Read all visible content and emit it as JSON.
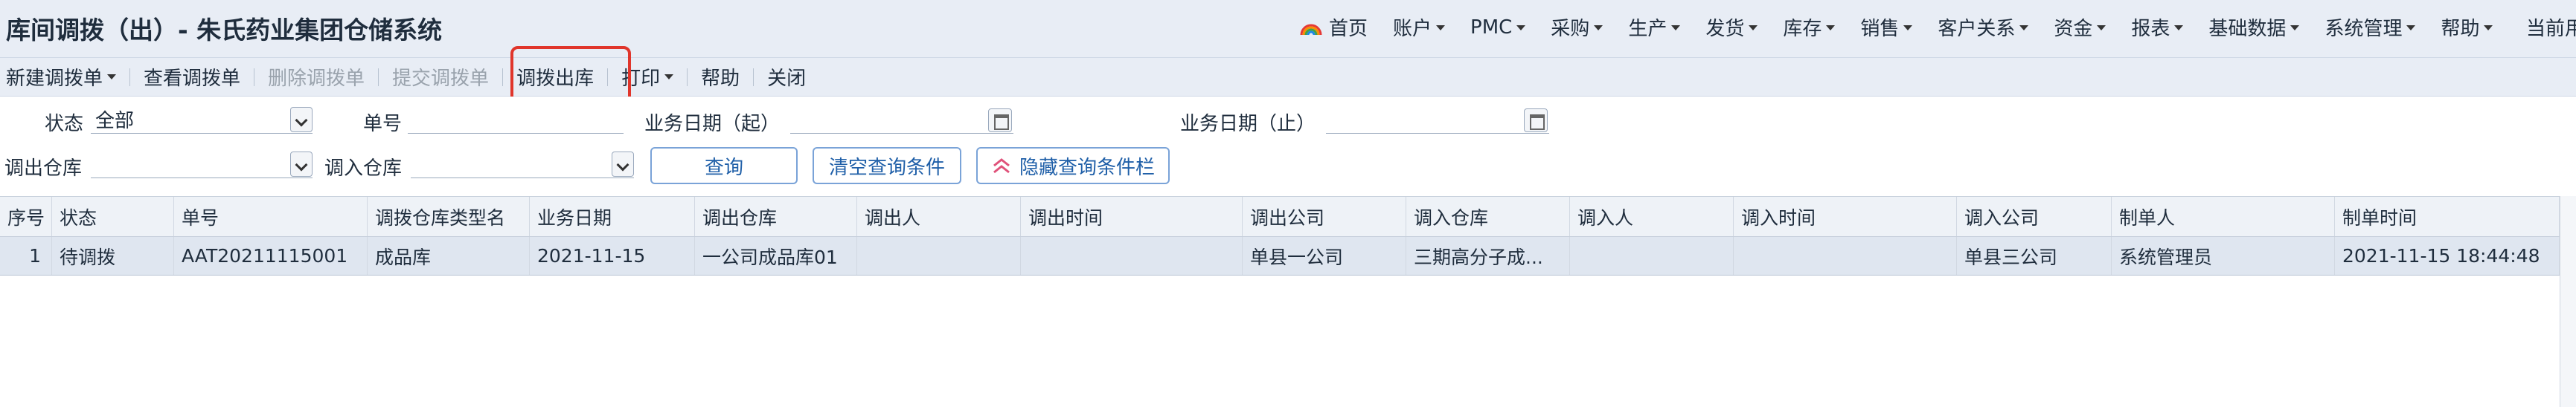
{
  "app": {
    "title": "库间调拨（出）- 朱氏药业集团仓储系统",
    "current_user_label": "当前用"
  },
  "topnav": [
    {
      "label": "首页",
      "icon": "rainbow-home-icon",
      "caret": false
    },
    {
      "label": "账户",
      "caret": true
    },
    {
      "label": "PMC",
      "caret": true
    },
    {
      "label": "采购",
      "caret": true
    },
    {
      "label": "生产",
      "caret": true
    },
    {
      "label": "发货",
      "caret": true
    },
    {
      "label": "库存",
      "caret": true
    },
    {
      "label": "销售",
      "caret": true
    },
    {
      "label": "客户关系",
      "caret": true
    },
    {
      "label": "资金",
      "caret": true
    },
    {
      "label": "报表",
      "caret": true
    },
    {
      "label": "基础数据",
      "caret": true
    },
    {
      "label": "系统管理",
      "caret": true
    },
    {
      "label": "帮助",
      "caret": true
    }
  ],
  "toolbar": {
    "new_transfer": "新建调拨单",
    "view_transfer": "查看调拨单",
    "delete_transfer": "删除调拨单",
    "submit_transfer": "提交调拨单",
    "transfer_out": "调拨出库",
    "print": "打印",
    "help": "帮助",
    "close": "关闭"
  },
  "filters": {
    "status_label": "状态",
    "status_value": "全部",
    "doc_no_label": "单号",
    "date_from_label": "业务日期（起）",
    "date_to_label": "业务日期（止）",
    "out_warehouse_label": "调出仓库",
    "in_warehouse_label": "调入仓库",
    "query_button": "查询",
    "clear_button": "清空查询条件",
    "hide_button": "隐藏查询条件栏"
  },
  "table": {
    "columns": [
      "序号",
      "状态",
      "单号",
      "调拨仓库类型名",
      "业务日期",
      "调出仓库",
      "调出人",
      "调出时间",
      "调出公司",
      "调入仓库",
      "调入人",
      "调入时间",
      "调入公司",
      "制单人",
      "制单时间"
    ],
    "rows": [
      [
        "1",
        "待调拨",
        "AAT20211115001",
        "成品库",
        "2021-11-15",
        "一公司成品库01",
        "",
        "",
        "单县一公司",
        "三期高分子成...",
        "",
        "",
        "单县三公司",
        "系统管理员",
        "2021-11-15 18:44:48"
      ]
    ]
  },
  "colors": {
    "highlight": "#e0352b",
    "bar_bg": "#e8edf5",
    "selected_row": "#dfe6f0",
    "button_text": "#1f5fa8"
  }
}
